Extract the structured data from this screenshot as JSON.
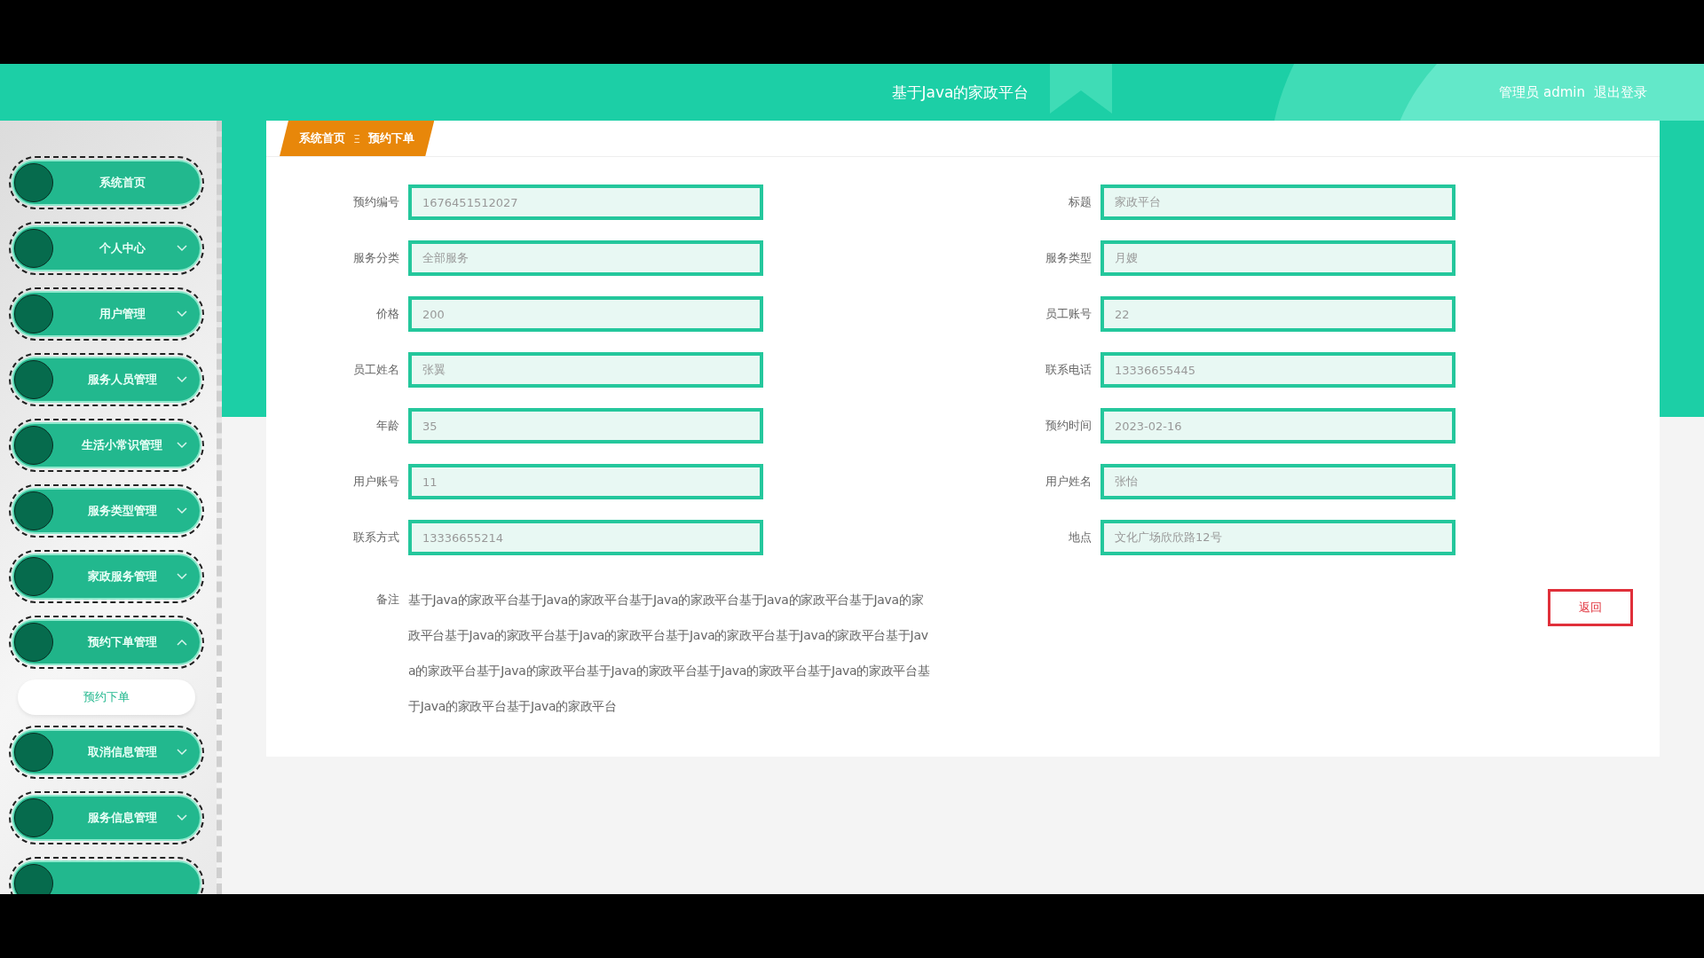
{
  "header": {
    "title": "基于Java的家政平台",
    "user": "管理员 admin",
    "logout": "退出登录"
  },
  "sidebar": {
    "items": [
      {
        "label": "系统首页",
        "kind": "link"
      },
      {
        "label": "个人中心",
        "kind": "group",
        "expanded": false
      },
      {
        "label": "用户管理",
        "kind": "group",
        "expanded": false
      },
      {
        "label": "服务人员管理",
        "kind": "group",
        "expanded": false
      },
      {
        "label": "生活小常识管理",
        "kind": "group",
        "expanded": false
      },
      {
        "label": "服务类型管理",
        "kind": "group",
        "expanded": false
      },
      {
        "label": "家政服务管理",
        "kind": "group",
        "expanded": false
      },
      {
        "label": "预约下单管理",
        "kind": "group",
        "expanded": true,
        "children": [
          {
            "label": "预约下单",
            "selected": true
          }
        ]
      },
      {
        "label": "取消信息管理",
        "kind": "group",
        "expanded": false
      },
      {
        "label": "服务信息管理",
        "kind": "group",
        "expanded": false
      }
    ]
  },
  "breadcrumb": {
    "items": [
      "系统首页",
      "预约下单"
    ],
    "separator": "Ξ"
  },
  "form": {
    "fields": [
      {
        "label": "预约编号",
        "value": "1676451512027"
      },
      {
        "label": "标题",
        "value": "家政平台"
      },
      {
        "label": "服务分类",
        "value": "全部服务"
      },
      {
        "label": "服务类型",
        "value": "月嫂"
      },
      {
        "label": "价格",
        "value": "200"
      },
      {
        "label": "员工账号",
        "value": "22"
      },
      {
        "label": "员工姓名",
        "value": "张翼"
      },
      {
        "label": "联系电话",
        "value": "13336655445"
      },
      {
        "label": "年龄",
        "value": "35"
      },
      {
        "label": "预约时间",
        "value": "2023-02-16"
      },
      {
        "label": "用户账号",
        "value": "11"
      },
      {
        "label": "用户姓名",
        "value": "张怡"
      },
      {
        "label": "联系方式",
        "value": "13336655214"
      },
      {
        "label": "地点",
        "value": "文化广场欣欣路12号"
      }
    ],
    "remark": {
      "label": "备注",
      "text": "基于Java的家政平台基于Java的家政平台基于Java的家政平台基于Java的家政平台基于Java的家政平台基于Java的家政平台基于Java的家政平台基于Java的家政平台基于Java的家政平台基于Java的家政平台基于Java的家政平台基于Java的家政平台基于Java的家政平台基于Java的家政平台基于Java的家政平台基于Java的家政平台"
    },
    "back_button": "返回"
  }
}
